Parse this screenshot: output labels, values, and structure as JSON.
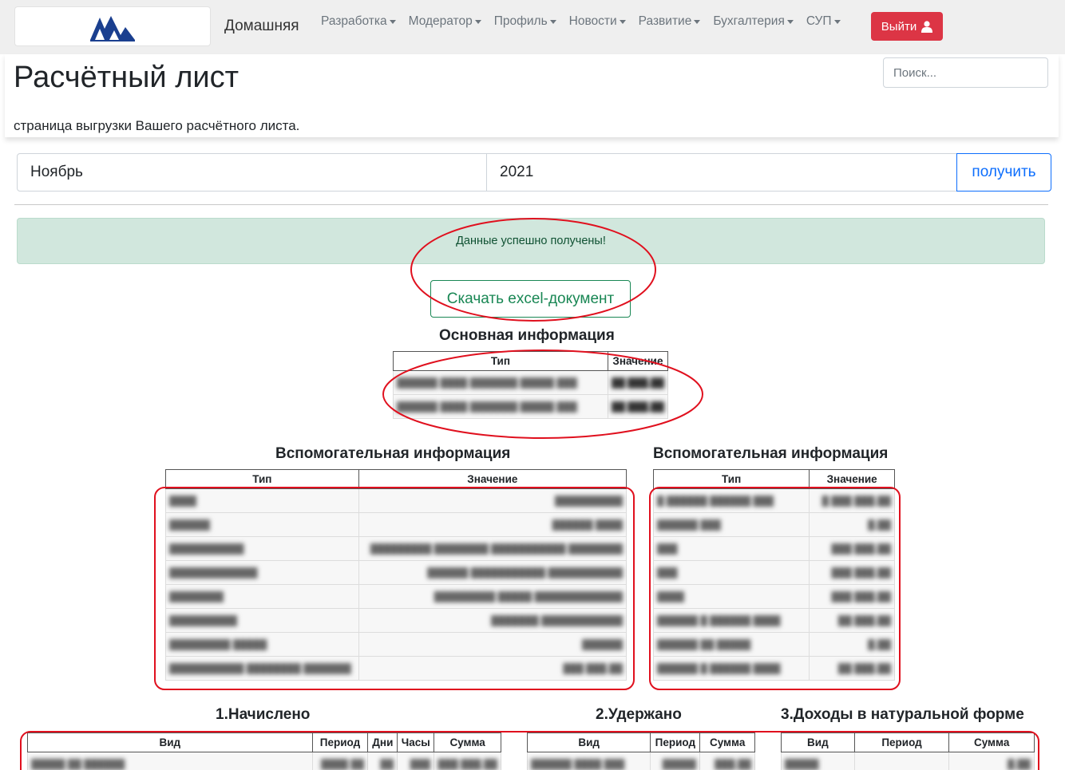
{
  "navbar": {
    "home": "Домашняя",
    "menu": [
      "Разработка",
      "Модератор",
      "Профиль",
      "Новости",
      "Развитие",
      "Бухгалтерия",
      "СУП"
    ],
    "logout": "Выйти"
  },
  "header": {
    "title": "Расчётный лист",
    "subtitle": "страница выгрузки Вашего расчётного листа.",
    "search_placeholder": "Поиск..."
  },
  "form": {
    "month": "Ноябрь",
    "year": "2021",
    "submit": "получить"
  },
  "alert": {
    "message": "Данные успешно получены!"
  },
  "download": {
    "label": "Скачать excel-документ"
  },
  "main_info": {
    "title": "Основная информация",
    "columns": [
      "Тип",
      "Значение"
    ]
  },
  "aux_left": {
    "title": "Вспомогательная информация",
    "columns": [
      "Тип",
      "Значение"
    ]
  },
  "aux_right": {
    "title": "Вспомогательная информация",
    "columns": [
      "Тип",
      "Значение"
    ]
  },
  "accrued": {
    "title": "1.Начислено",
    "columns": [
      "Вид",
      "Период",
      "Дни",
      "Часы",
      "Сумма"
    ]
  },
  "withheld": {
    "title": "2.Удержано",
    "columns": [
      "Вид",
      "Период",
      "Сумма"
    ]
  },
  "in_kind": {
    "title": "3.Доходы в натуральной форме",
    "columns": [
      "Вид",
      "Период",
      "Сумма"
    ]
  },
  "colors": {
    "danger": "#dc3545",
    "primary": "#0d6efd",
    "success": "#198754",
    "alert_bg": "#d1e7dd",
    "annotation": "#e0101e"
  }
}
